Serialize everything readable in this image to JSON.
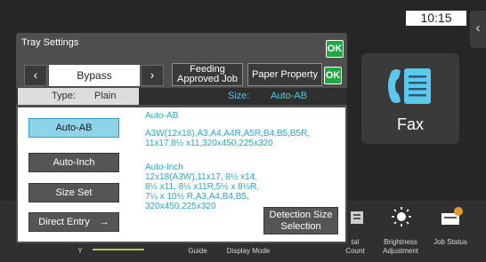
{
  "statusbar": {
    "time": "10:15",
    "side_tab_icon": "chevron-left-icon"
  },
  "home": {
    "fax_label": "Fax",
    "bottom_bar": {
      "left_fragment": "Y",
      "guide": "Guide",
      "display_mode": "Display Mode",
      "total_count_fragment": "tal\nCount",
      "brightness": "Brightness\nAdjustment",
      "job_status": "Job Status"
    }
  },
  "dialog": {
    "title": "Tray Settings",
    "ok": "OK",
    "tray_nav": {
      "current_tray": "Bypass",
      "prev_icon": "chevron-left-icon",
      "next_icon": "chevron-right-icon"
    },
    "tabs": {
      "feeding": "Feeding\nApproved Job",
      "paper": "Paper Property",
      "paper_ok": "OK"
    },
    "type_label": "Type:",
    "type_value": "Plain",
    "size_label": "Size:",
    "size_value": "Auto-AB",
    "options": {
      "auto_ab": "Auto-AB",
      "auto_inch": "Auto-Inch",
      "size_set": "Size Set",
      "direct_entry": "Direct Entry",
      "direct_entry_icon": "arrow-right-icon"
    },
    "auto_ab_heading": "Auto-AB",
    "auto_ab_sizes": "A3W(12x18),A3,A4,A4R,A5R,B4,B5,B5R,\n11x17,8½ x11,320x450,225x320",
    "auto_inch_heading": "Auto-Inch",
    "auto_inch_sizes": "12x18(A3W),11x17, 8½ x14,\n8½ x11, 8½ x11R,5½ x 8½R,\n7¼ x 10½ R,A3,A4,B4,B5,\n320x450,225x320",
    "detect_button": "Detection Size\nSelection"
  },
  "colors": {
    "accent_green": "#22a843",
    "selected_cyan": "#8fd3e8",
    "text_cyan": "#2aa6cf"
  }
}
